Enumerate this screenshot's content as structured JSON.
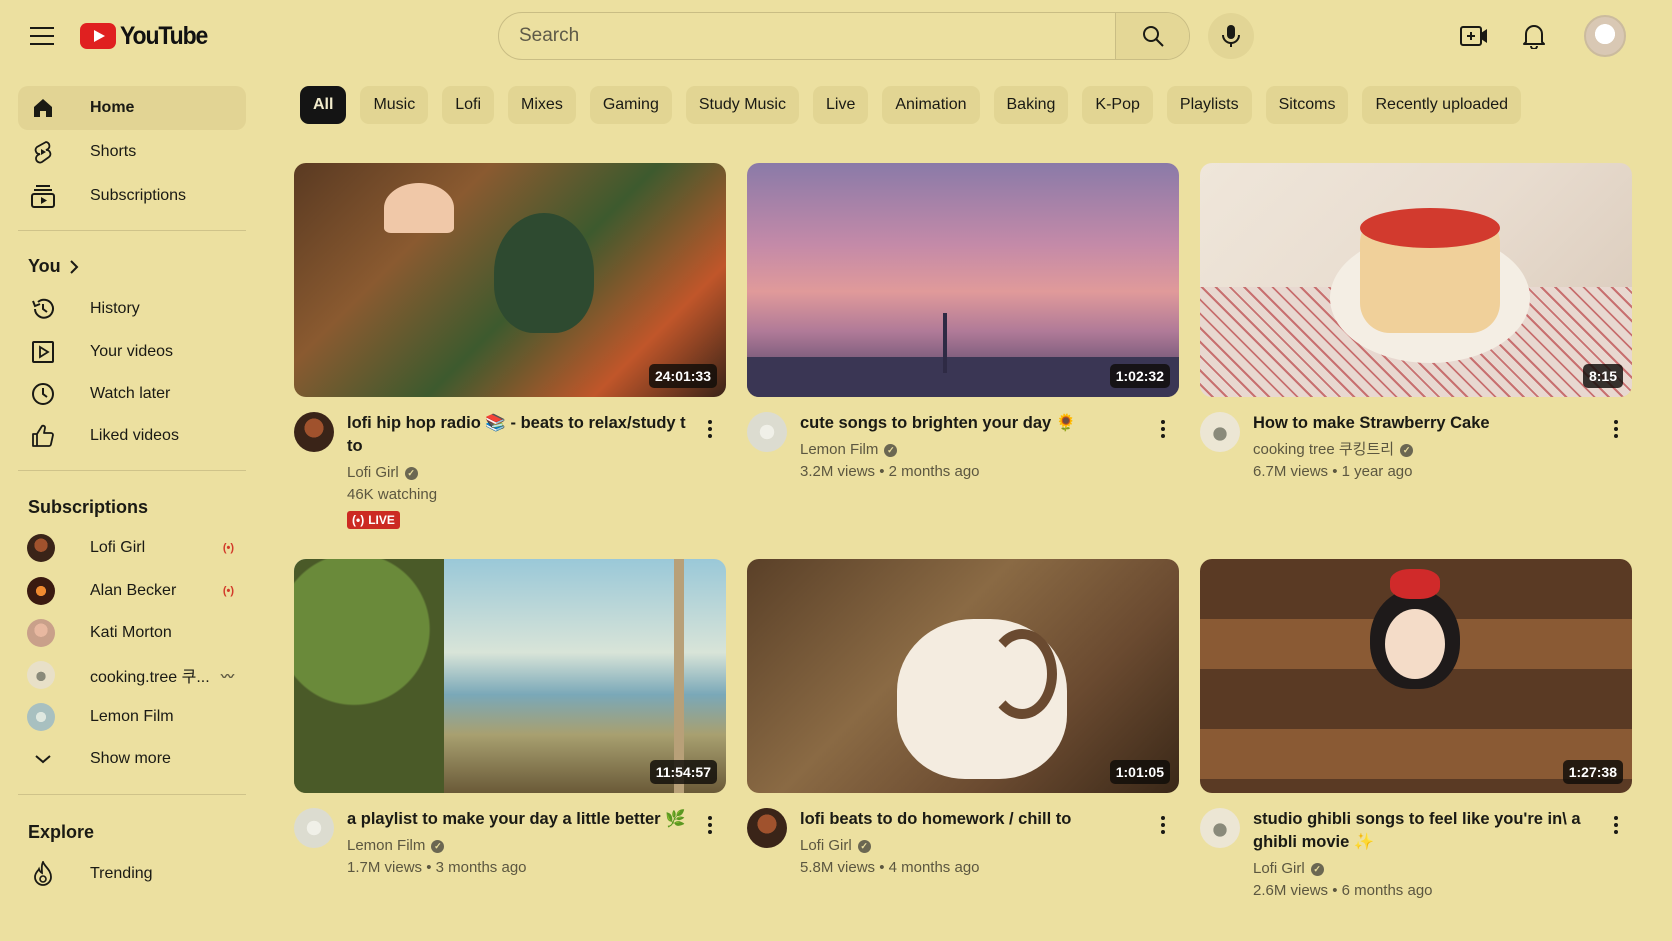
{
  "header": {
    "logo_text": "YouTube",
    "search_placeholder": "Search",
    "icons": [
      "menu-icon",
      "search-icon",
      "mic-icon",
      "create-icon",
      "bell-icon"
    ]
  },
  "sidebar": {
    "main": [
      {
        "label": "Home",
        "icon": "home-icon"
      },
      {
        "label": "Shorts",
        "icon": "shorts-icon"
      },
      {
        "label": "Subscriptions",
        "icon": "subscriptions-icon"
      }
    ],
    "you_heading": "You",
    "you": [
      {
        "label": "History",
        "icon": "history-icon"
      },
      {
        "label": "Your videos",
        "icon": "your-videos-icon"
      },
      {
        "label": "Watch later",
        "icon": "watch-later-icon"
      },
      {
        "label": "Liked videos",
        "icon": "liked-icon"
      }
    ],
    "subscriptions_heading": "Subscriptions",
    "subscriptions": [
      {
        "label": "Lofi Girl",
        "status": "live"
      },
      {
        "label": "Alan Becker",
        "status": "live"
      },
      {
        "label": "Kati Morton",
        "status": ""
      },
      {
        "label": "cooking.tree 쿠...",
        "status": "new"
      },
      {
        "label": "Lemon Film",
        "status": ""
      }
    ],
    "show_more": "Show more",
    "explore_heading": "Explore",
    "explore": [
      {
        "label": "Trending",
        "icon": "trending-icon"
      }
    ]
  },
  "chips": [
    "All",
    "Music",
    "Lofi",
    "Mixes",
    "Gaming",
    "Study Music",
    "Live",
    "Animation",
    "Baking",
    "K-Pop",
    "Playlists",
    "Sitcoms",
    "Recently uploaded"
  ],
  "videos": [
    {
      "title": "lofi hip hop radio 📚 - beats to relax/study t to",
      "channel": "Lofi Girl",
      "stats": "46K watching",
      "duration": "24:01:33",
      "live": "LIVE"
    },
    {
      "title": "cute songs to brighten your day 🌻",
      "channel": "Lemon Film",
      "stats": "3.2M views • 2 months ago",
      "duration": "1:02:32"
    },
    {
      "title": "How to make Strawberry Cake",
      "channel": "cooking tree 쿠킹트리",
      "stats": "6.7M views • 1 year ago",
      "duration": "8:15"
    },
    {
      "title": "a playlist to make your day a little better 🌿",
      "channel": "Lemon Film",
      "stats": "1.7M views • 3 months ago",
      "duration": "11:54:57"
    },
    {
      "title": "lofi beats to do homework / chill to",
      "channel": "Lofi Girl",
      "stats": "5.8M views • 4 months ago",
      "duration": "1:01:05"
    },
    {
      "title": "studio ghibli songs to feel like you're in\\ a ghibli movie ✨",
      "channel": "Lofi Girl",
      "stats": "2.6M views • 6 months ago",
      "duration": "1:27:38"
    }
  ],
  "colors": {
    "background": "#ece0a0",
    "brand_red": "#e02020",
    "live_red": "#cc2a22"
  }
}
